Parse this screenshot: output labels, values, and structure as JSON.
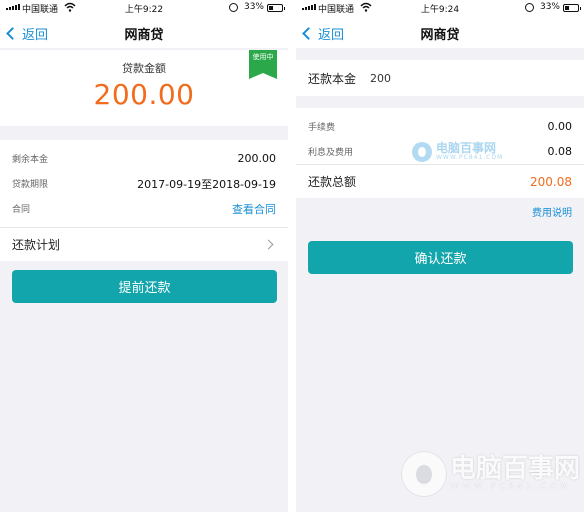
{
  "left": {
    "status": {
      "carrier": "中国联通",
      "time": "上午9:22",
      "battery": "33%"
    },
    "nav": {
      "back_label": "返回",
      "title": "网商贷"
    },
    "amount": {
      "label": "贷款金额",
      "value": "200.00",
      "tag": "使用中"
    },
    "details": [
      {
        "key": "剩余本金",
        "value": "200.00"
      },
      {
        "key": "贷款期限",
        "value": "2017-09-19至2018-09-19"
      },
      {
        "key": "合同",
        "value": "查看合同"
      }
    ],
    "plan_label": "还款计划",
    "button_label": "提前还款"
  },
  "right": {
    "status": {
      "carrier": "中国联通",
      "time": "上午9:24",
      "battery": "33%"
    },
    "nav": {
      "back_label": "返回",
      "title": "网商贷"
    },
    "principal": {
      "label": "还款本金",
      "value": "200"
    },
    "fees": [
      {
        "key": "手续费",
        "value": "0.00"
      },
      {
        "key": "利息及费用",
        "value": "0.08"
      }
    ],
    "total": {
      "label": "还款总额",
      "value": "200.08"
    },
    "fee_note": "费用说明",
    "button_label": "确认还款"
  },
  "watermark": {
    "name": "电脑百事网",
    "url": "WWW.PC841.COM"
  },
  "colors": {
    "accent_blue": "#1a8fd6",
    "amount_orange": "#f26c1d",
    "button_teal": "#12a5ac",
    "tag_green": "#2aa84a"
  }
}
